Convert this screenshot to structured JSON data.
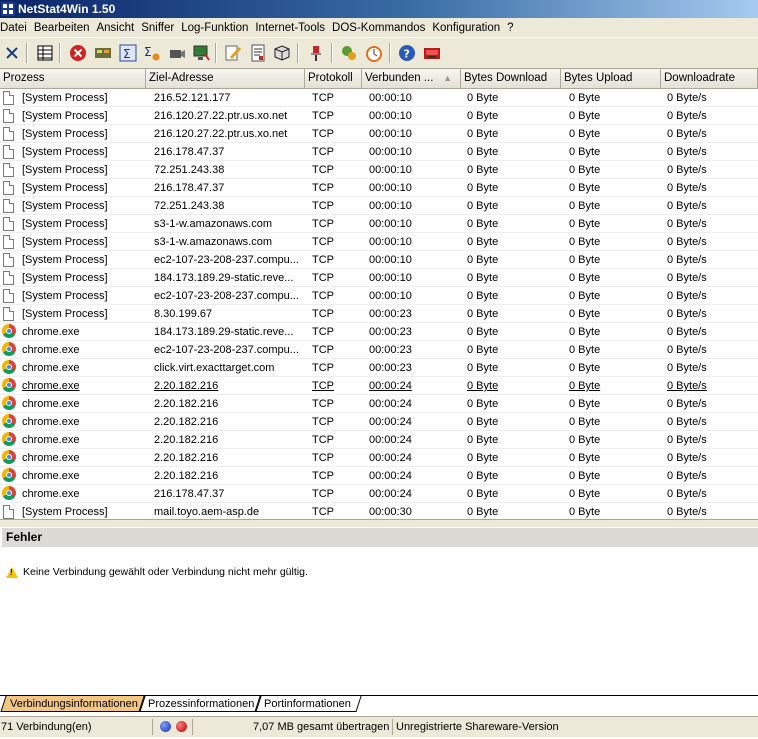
{
  "window": {
    "title": "NetStat4Win 1.50"
  },
  "menu": [
    "Datei",
    "Bearbeiten",
    "Ansicht",
    "Sniffer",
    "Log-Funktion",
    "Internet-Tools",
    "DOS-Kommandos",
    "Konfiguration",
    "?"
  ],
  "toolbar": {
    "icons": [
      "close-icon",
      "grid-view-icon",
      "stop-icon",
      "network-icon",
      "sum-icon",
      "sum-config-icon",
      "camera-icon",
      "monitor-icon",
      "edit-icon",
      "report-icon",
      "cube-icon",
      "pin-icon",
      "tools-icon",
      "timer-icon",
      "help-icon",
      "exit-icon"
    ]
  },
  "columns": [
    "Prozess",
    "Ziel-Adresse",
    "Protokoll",
    "Verbunden ...",
    "Bytes Download",
    "Bytes Upload",
    "Downloadrate"
  ],
  "rows": [
    {
      "icon": "file-icon",
      "process": "[System Process]",
      "address": "216.52.121.177",
      "protocol": "TCP",
      "connected": "00:00:10",
      "down": "0 Byte",
      "up": "0 Byte",
      "rate": "0 Byte/s"
    },
    {
      "icon": "file-icon",
      "process": "[System Process]",
      "address": "216.120.27.22.ptr.us.xo.net",
      "protocol": "TCP",
      "connected": "00:00:10",
      "down": "0 Byte",
      "up": "0 Byte",
      "rate": "0 Byte/s"
    },
    {
      "icon": "file-icon",
      "process": "[System Process]",
      "address": "216.120.27.22.ptr.us.xo.net",
      "protocol": "TCP",
      "connected": "00:00:10",
      "down": "0 Byte",
      "up": "0 Byte",
      "rate": "0 Byte/s"
    },
    {
      "icon": "file-icon",
      "process": "[System Process]",
      "address": "216.178.47.37",
      "protocol": "TCP",
      "connected": "00:00:10",
      "down": "0 Byte",
      "up": "0 Byte",
      "rate": "0 Byte/s"
    },
    {
      "icon": "file-icon",
      "process": "[System Process]",
      "address": "72.251.243.38",
      "protocol": "TCP",
      "connected": "00:00:10",
      "down": "0 Byte",
      "up": "0 Byte",
      "rate": "0 Byte/s"
    },
    {
      "icon": "file-icon",
      "process": "[System Process]",
      "address": "216.178.47.37",
      "protocol": "TCP",
      "connected": "00:00:10",
      "down": "0 Byte",
      "up": "0 Byte",
      "rate": "0 Byte/s"
    },
    {
      "icon": "file-icon",
      "process": "[System Process]",
      "address": "72.251.243.38",
      "protocol": "TCP",
      "connected": "00:00:10",
      "down": "0 Byte",
      "up": "0 Byte",
      "rate": "0 Byte/s"
    },
    {
      "icon": "file-icon",
      "process": "[System Process]",
      "address": "s3-1-w.amazonaws.com",
      "protocol": "TCP",
      "connected": "00:00:10",
      "down": "0 Byte",
      "up": "0 Byte",
      "rate": "0 Byte/s"
    },
    {
      "icon": "file-icon",
      "process": "[System Process]",
      "address": "s3-1-w.amazonaws.com",
      "protocol": "TCP",
      "connected": "00:00:10",
      "down": "0 Byte",
      "up": "0 Byte",
      "rate": "0 Byte/s"
    },
    {
      "icon": "file-icon",
      "process": "[System Process]",
      "address": "ec2-107-23-208-237.compu...",
      "protocol": "TCP",
      "connected": "00:00:10",
      "down": "0 Byte",
      "up": "0 Byte",
      "rate": "0 Byte/s"
    },
    {
      "icon": "file-icon",
      "process": "[System Process]",
      "address": "184.173.189.29-static.reve...",
      "protocol": "TCP",
      "connected": "00:00:10",
      "down": "0 Byte",
      "up": "0 Byte",
      "rate": "0 Byte/s"
    },
    {
      "icon": "file-icon",
      "process": "[System Process]",
      "address": "ec2-107-23-208-237.compu...",
      "protocol": "TCP",
      "connected": "00:00:10",
      "down": "0 Byte",
      "up": "0 Byte",
      "rate": "0 Byte/s"
    },
    {
      "icon": "file-icon",
      "process": "[System Process]",
      "address": "8.30.199.67",
      "protocol": "TCP",
      "connected": "00:00:23",
      "down": "0 Byte",
      "up": "0 Byte",
      "rate": "0 Byte/s"
    },
    {
      "icon": "chrome-icon",
      "process": "chrome.exe",
      "address": "184.173.189.29-static.reve...",
      "protocol": "TCP",
      "connected": "00:00:23",
      "down": "0 Byte",
      "up": "0 Byte",
      "rate": "0 Byte/s"
    },
    {
      "icon": "chrome-icon",
      "process": "chrome.exe",
      "address": "ec2-107-23-208-237.compu...",
      "protocol": "TCP",
      "connected": "00:00:23",
      "down": "0 Byte",
      "up": "0 Byte",
      "rate": "0 Byte/s"
    },
    {
      "icon": "chrome-icon",
      "process": "chrome.exe",
      "address": "click.virt.exacttarget.com",
      "protocol": "TCP",
      "connected": "00:00:23",
      "down": "0 Byte",
      "up": "0 Byte",
      "rate": "0 Byte/s"
    },
    {
      "icon": "chrome-icon",
      "process": "chrome.exe",
      "address": "2.20.182.216",
      "protocol": "TCP",
      "connected": "00:00:24",
      "down": "0 Byte",
      "up": "0 Byte",
      "rate": "0 Byte/s",
      "underline": true
    },
    {
      "icon": "chrome-icon",
      "process": "chrome.exe",
      "address": "2.20.182.216",
      "protocol": "TCP",
      "connected": "00:00:24",
      "down": "0 Byte",
      "up": "0 Byte",
      "rate": "0 Byte/s"
    },
    {
      "icon": "chrome-icon",
      "process": "chrome.exe",
      "address": "2.20.182.216",
      "protocol": "TCP",
      "connected": "00:00:24",
      "down": "0 Byte",
      "up": "0 Byte",
      "rate": "0 Byte/s"
    },
    {
      "icon": "chrome-icon",
      "process": "chrome.exe",
      "address": "2.20.182.216",
      "protocol": "TCP",
      "connected": "00:00:24",
      "down": "0 Byte",
      "up": "0 Byte",
      "rate": "0 Byte/s"
    },
    {
      "icon": "chrome-icon",
      "process": "chrome.exe",
      "address": "2.20.182.216",
      "protocol": "TCP",
      "connected": "00:00:24",
      "down": "0 Byte",
      "up": "0 Byte",
      "rate": "0 Byte/s"
    },
    {
      "icon": "chrome-icon",
      "process": "chrome.exe",
      "address": "2.20.182.216",
      "protocol": "TCP",
      "connected": "00:00:24",
      "down": "0 Byte",
      "up": "0 Byte",
      "rate": "0 Byte/s"
    },
    {
      "icon": "chrome-icon",
      "process": "chrome.exe",
      "address": "216.178.47.37",
      "protocol": "TCP",
      "connected": "00:00:24",
      "down": "0 Byte",
      "up": "0 Byte",
      "rate": "0 Byte/s"
    },
    {
      "icon": "file-icon",
      "process": "[System Process]",
      "address": "mail.toyo.aem-asp.de",
      "protocol": "TCP",
      "connected": "00:00:30",
      "down": "0 Byte",
      "up": "0 Byte",
      "rate": "0 Byte/s"
    }
  ],
  "error_panel": {
    "title": "Fehler",
    "message": "Keine Verbindung gewählt oder Verbindung nicht mehr gültig."
  },
  "tabs": [
    "Verbindungsinformationen",
    "Prozessinformationen",
    "Portinformationen"
  ],
  "status": {
    "connections": "71 Verbindung(en)",
    "transferred": "7,07 MB gesamt übertragen",
    "license": "Unregistrierte Shareware-Version"
  },
  "colors": {
    "active_tab": "#f3c684",
    "titlebar": "#0a246a",
    "panel": "#ece9d8"
  }
}
